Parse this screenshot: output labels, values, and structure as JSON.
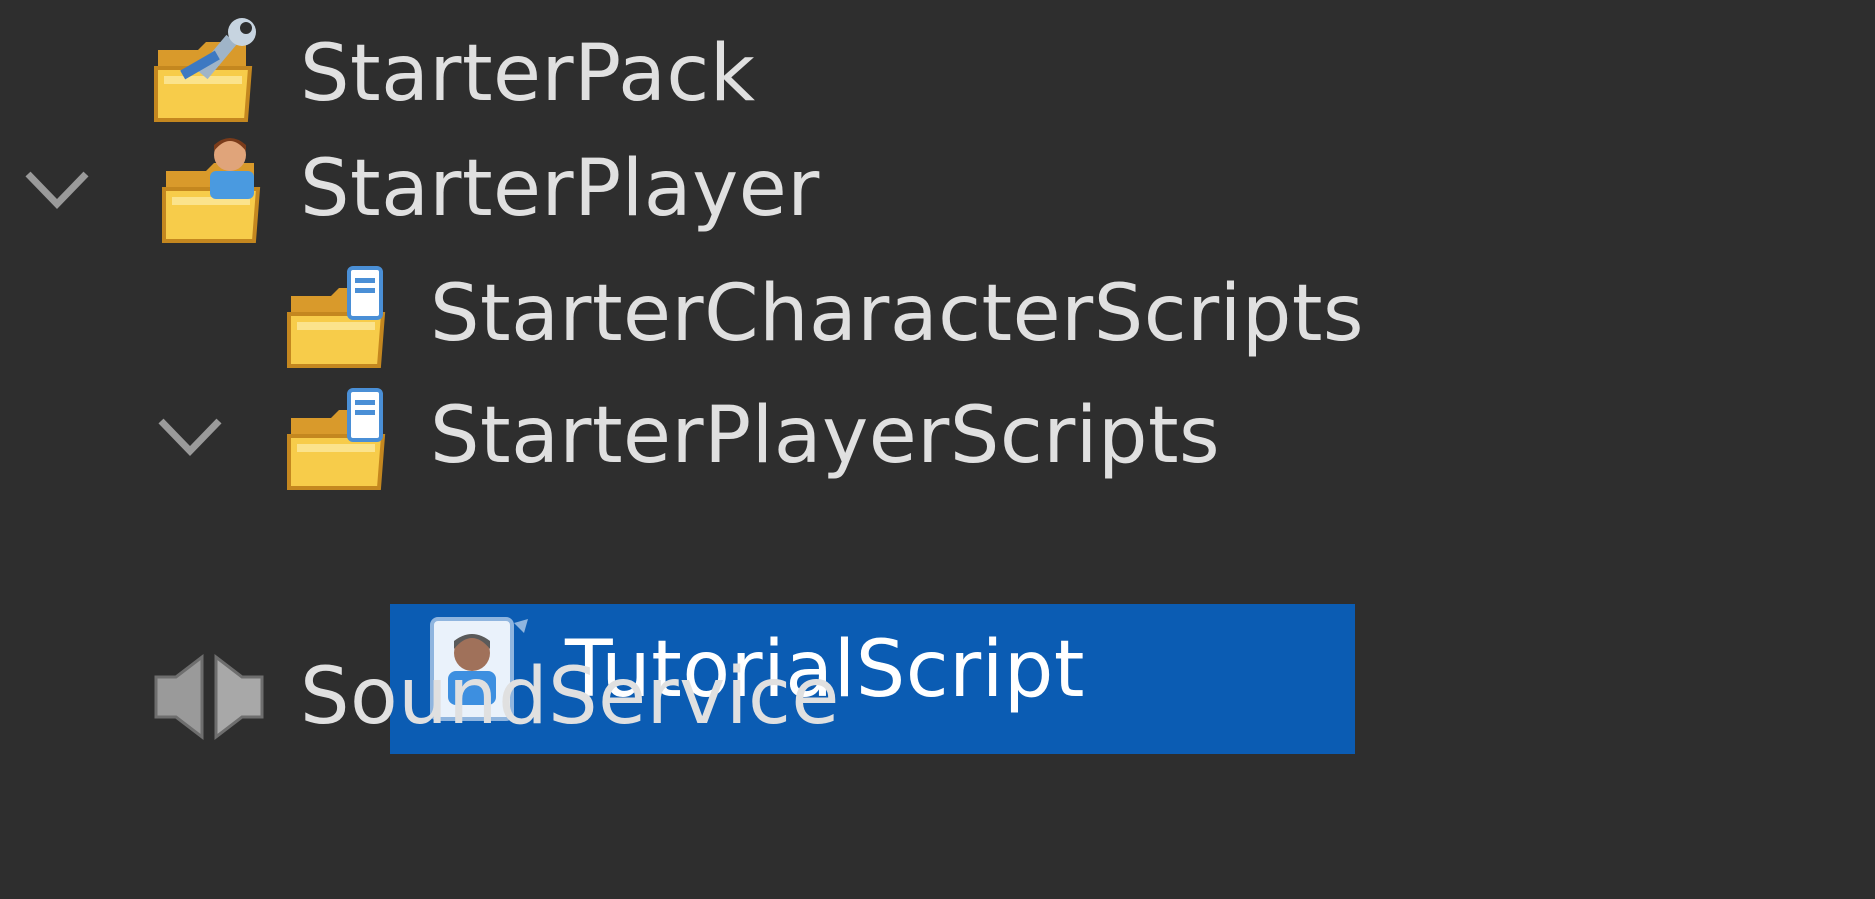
{
  "tree": {
    "items": [
      {
        "label": "StarterPack",
        "icon": "starter-pack-icon",
        "expanded": null,
        "selected": false
      },
      {
        "label": "StarterPlayer",
        "icon": "starter-player-icon",
        "expanded": true,
        "selected": false
      },
      {
        "label": "StarterCharacterScripts",
        "icon": "script-folder-icon",
        "expanded": null,
        "selected": false
      },
      {
        "label": "StarterPlayerScripts",
        "icon": "script-folder-icon",
        "expanded": true,
        "selected": false
      },
      {
        "label": "TutorialScript",
        "icon": "local-script-icon",
        "expanded": null,
        "selected": true
      },
      {
        "label": "SoundService",
        "icon": "sound-service-icon",
        "expanded": null,
        "selected": false
      }
    ]
  },
  "colors": {
    "background": "#2e2e2e",
    "selection": "#0b5cb3",
    "text": "#e0e0e0",
    "folder": "#f5c541"
  }
}
